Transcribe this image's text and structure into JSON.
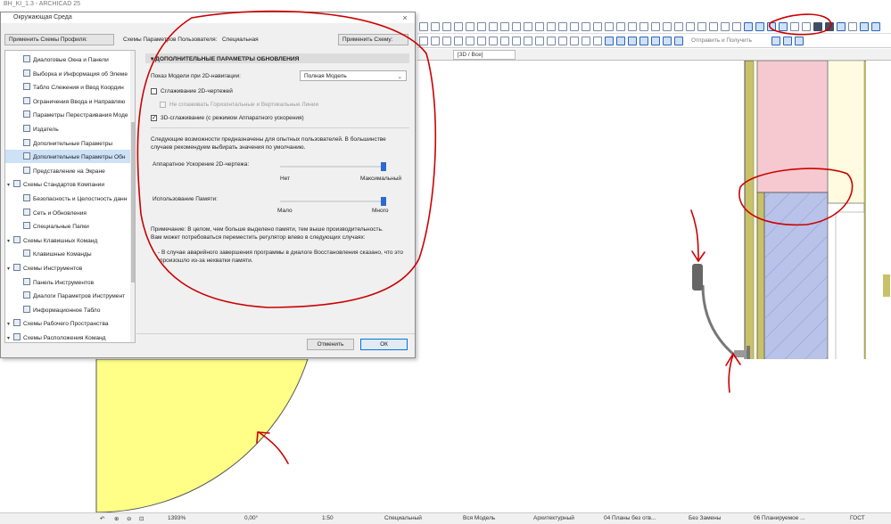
{
  "app": {
    "title": "BH_KI_1.3 - ARCHICAD 25"
  },
  "dialog": {
    "title": "Окружающая Среда",
    "close": "×",
    "profile_button": "Применить Схемы Профиля:",
    "user_schemes_label": "Схемы Параметров Пользователя:",
    "user_schemes_value": "Специальная",
    "apply_scheme_button": "Применить Схему:",
    "tree": [
      {
        "label": "Диалоговые Окна и Панели",
        "level": 1,
        "selected": false
      },
      {
        "label": "Выборка и Информация об Элеме",
        "level": 1,
        "selected": false
      },
      {
        "label": "Табло Слежения и Ввод Координ",
        "level": 1,
        "selected": false
      },
      {
        "label": "Ограничения Ввода и Направляю",
        "level": 1,
        "selected": false
      },
      {
        "label": "Параметры Перестраивания Моде",
        "level": 1,
        "selected": false
      },
      {
        "label": "Издатель",
        "level": 1,
        "selected": false
      },
      {
        "label": "Дополнительные Параметры",
        "level": 1,
        "selected": false
      },
      {
        "label": "Дополнительные Параметры Обн",
        "level": 1,
        "selected": true
      },
      {
        "label": "Представление на Экране",
        "level": 1,
        "selected": false
      },
      {
        "label": "Схемы Стандартов Компании",
        "level": 0,
        "selected": false
      },
      {
        "label": "Безопасность и Целостность данн",
        "level": 1,
        "selected": false
      },
      {
        "label": "Сеть и Обновления",
        "level": 1,
        "selected": false
      },
      {
        "label": "Специальные Папки",
        "level": 1,
        "selected": false
      },
      {
        "label": "Схемы Клавишных Команд",
        "level": 0,
        "selected": false
      },
      {
        "label": "Клавишные Команды",
        "level": 1,
        "selected": false
      },
      {
        "label": "Схемы Инструментов",
        "level": 0,
        "selected": false
      },
      {
        "label": "Панель Инструментов",
        "level": 1,
        "selected": false
      },
      {
        "label": "Диалоги Параметров Инструмент",
        "level": 1,
        "selected": false
      },
      {
        "label": "Информационное Табло",
        "level": 1,
        "selected": false
      },
      {
        "label": "Схемы Рабочего Пространства",
        "level": 0,
        "selected": false
      },
      {
        "label": "Схемы Расположения Команд",
        "level": 0,
        "selected": false
      }
    ],
    "section_title": "ДОПОЛНИТЕЛЬНЫЕ ПАРАМЕТРЫ ОБНОВЛЕНИЯ",
    "model_view_label": "Показ Модели при 2D-навигации:",
    "model_view_value": "Полная Модель",
    "smoothing_2d_label": "Сглаживание 2D-чертежей",
    "smoothing_2d_checked": false,
    "no_smooth_lines_label": "Не сглаживать Горизонтальные и Вертикальные Линии",
    "smoothing_3d_label": "3D-сглаживание (с режимом Аппаратного ускорения)",
    "smoothing_3d_checked": true,
    "info_text_1": "Следующие возможности предназначены для опытных пользователей. В большинстве",
    "info_text_2": "случаев рекомендуем выбирать значения по умолчанию.",
    "hw_accel_label": "Аппаратное Ускорение 2D-чертежа:",
    "hw_accel_min": "Нет",
    "hw_accel_max": "Максимальный",
    "hw_accel_level": 1.0,
    "memory_label": "Использование Памяти:",
    "memory_min": "Мало",
    "memory_max": "Много",
    "memory_level": 1.0,
    "note_1": "Примечание: В целом, чем больше выделено памяти, тем выше производительность.",
    "note_2": "Вам может потребоваться переместить регулятор влево в следующих случаях:",
    "note_3": "- В случае аварийного завершения программы в диалоге Восстановления сказано, что это",
    "note_4": "произошло из-за нехватки памяти.",
    "cancel_button": "Отменить",
    "ok_button": "ОК"
  },
  "toolbar": {
    "send_receive_label": "Отправить и Получить"
  },
  "view_tab": {
    "label": "[3D / Все]"
  },
  "statusbar": {
    "zoom": "1393%",
    "angle": "0,00°",
    "scale": "1:50",
    "layer_combo": "Специальный",
    "model_view": "Вся Модель",
    "pen_set": "Архитектурный",
    "view_1": "04 Планы без отв...",
    "override": "Без Замены",
    "view_2": "06 Планируемое ...",
    "standard": "ГОСТ"
  },
  "colors": {
    "annotation": "#cc0000",
    "yellow": "#ffff88",
    "pink": "#f6c9d0",
    "wall_olive": "#c9c16a",
    "hatch": "#b9c2e8",
    "accent": "#2b6bd1"
  }
}
